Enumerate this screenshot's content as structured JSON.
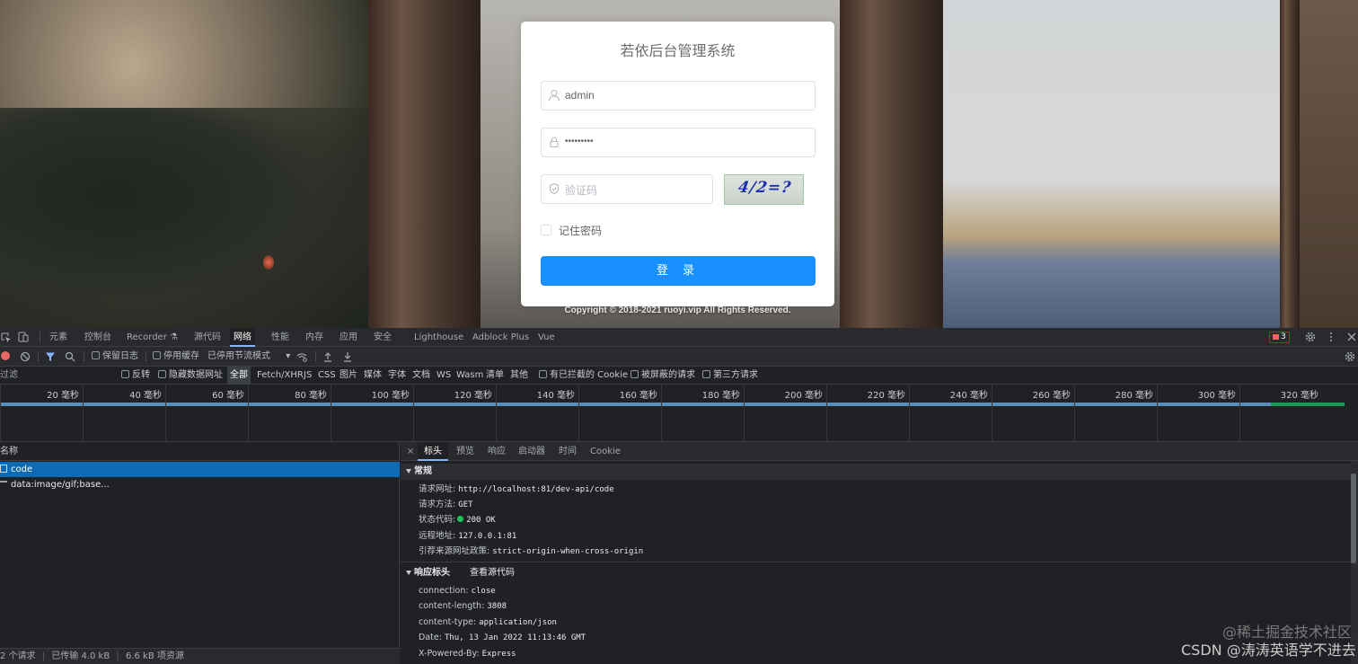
{
  "login": {
    "title": "若依后台管理系统",
    "username_value": "admin",
    "password_value": "•••••••••",
    "captcha_placeholder": "验证码",
    "captcha_text": "4/2=?",
    "remember_label": "记住密码",
    "login_button": "登 录",
    "copyright": "Copyright © 2018-2021 ruoyi.vip All Rights Reserved.",
    "colors": {
      "primary": "#1890ff"
    }
  },
  "devtools": {
    "main_tabs": [
      "元素",
      "控制台",
      "Recorder",
      "源代码",
      "网络",
      "性能",
      "内存",
      "应用",
      "安全",
      "Lighthouse",
      "Adblock Plus",
      "Vue"
    ],
    "active_tab": "网络",
    "error_count": "3",
    "toolbar": {
      "preserve_log": "保留日志",
      "disable_cache": "停用缓存",
      "throttling": "已停用节流模式"
    },
    "filter": {
      "placeholder": "过滤",
      "invert": "反转",
      "hide_data_urls": "隐藏数据网址",
      "types": [
        "全部",
        "Fetch/XHR",
        "JS",
        "CSS",
        "图片",
        "媒体",
        "字体",
        "文档",
        "WS",
        "Wasm",
        "清单",
        "其他"
      ],
      "active_type": "全部",
      "blocked_cookies": "有已拦截的 Cookie",
      "blocked_requests": "被屏蔽的请求",
      "third_party": "第三方请求"
    },
    "timeline_ticks": [
      "20 毫秒",
      "40 毫秒",
      "60 毫秒",
      "80 毫秒",
      "100 毫秒",
      "120 毫秒",
      "140 毫秒",
      "160 毫秒",
      "180 毫秒",
      "200 毫秒",
      "220 毫秒",
      "240 毫秒",
      "260 毫秒",
      "280 毫秒",
      "300 毫秒",
      "320 毫秒"
    ],
    "requests": {
      "header": "名称",
      "rows": [
        "code",
        "data:image/gif;base..."
      ]
    },
    "status_bar": {
      "requests": "2 个请求",
      "transferred": "已传输 4.0 kB",
      "resources": "6.6 kB 项资源"
    },
    "detail": {
      "tabs": [
        "标头",
        "预览",
        "响应",
        "启动器",
        "时间",
        "Cookie"
      ],
      "active_tab": "标头",
      "general_title": "常规",
      "general": [
        {
          "k": "请求网址:",
          "v": "http://localhost:81/dev-api/code"
        },
        {
          "k": "请求方法:",
          "v": "GET"
        },
        {
          "k": "状态代码:",
          "v": "200 OK"
        },
        {
          "k": "远程地址:",
          "v": "127.0.0.1:81"
        },
        {
          "k": "引荐来源网址政策:",
          "v": "strict-origin-when-cross-origin"
        }
      ],
      "response_title": "响应标头",
      "view_source": "查看源代码",
      "response_headers": [
        {
          "k": "connection:",
          "v": "close"
        },
        {
          "k": "content-length:",
          "v": "3808"
        },
        {
          "k": "content-type:",
          "v": "application/json"
        },
        {
          "k": "Date:",
          "v": "Thu, 13 Jan 2022 11:13:46 GMT"
        },
        {
          "k": "X-Powered-By:",
          "v": "Express"
        }
      ]
    }
  },
  "watermark": {
    "line1": "@稀土掘金技术社区",
    "line2": "CSDN @涛涛英语学不进去"
  }
}
